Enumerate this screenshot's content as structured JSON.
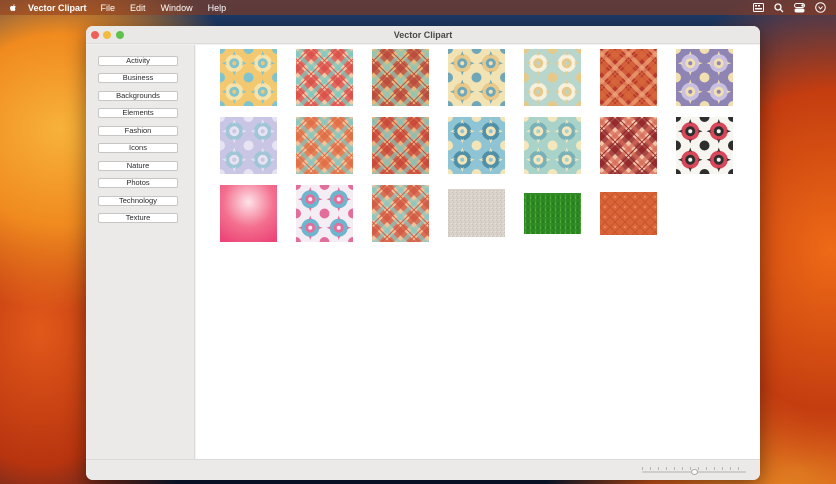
{
  "menubar": {
    "app_name": "Vector Clipart",
    "items": [
      "File",
      "Edit",
      "Window",
      "Help"
    ]
  },
  "window": {
    "title": "Vector Clipart"
  },
  "sidebar": {
    "categories": [
      "Activity",
      "Business",
      "Backgrounds",
      "Elements",
      "Fashion",
      "Icons",
      "Nature",
      "Photos",
      "Technology",
      "Texture"
    ]
  },
  "gallery": {
    "thumbnails": [
      {
        "name": "mandala-yellow-blue",
        "pattern": "mandala",
        "colors": [
          "#f2c870",
          "#7fc3cf",
          "#f7e2a8"
        ]
      },
      {
        "name": "plaid-red-teal",
        "pattern": "plaid",
        "colors": [
          "#d94b47",
          "#74c9c4",
          "#f4c9a6"
        ]
      },
      {
        "name": "plaid-red-olive",
        "pattern": "plaid",
        "colors": [
          "#b6453a",
          "#8cc6b8",
          "#e8b97a"
        ]
      },
      {
        "name": "mandala-cream-teal",
        "pattern": "mandala",
        "colors": [
          "#f2e3b4",
          "#6fa7b8",
          "#e9c989"
        ]
      },
      {
        "name": "mandala-teal-cream",
        "pattern": "mandala",
        "colors": [
          "#b9d6cc",
          "#e6c98a",
          "#f6f0dc"
        ]
      },
      {
        "name": "plaid-orange-red",
        "pattern": "plaid",
        "colors": [
          "#d9683a",
          "#f1a77a",
          "#b83a2f"
        ]
      },
      {
        "name": "mandala-purple-cream",
        "pattern": "mandala",
        "colors": [
          "#8f85b5",
          "#f1dfb0",
          "#c9bfe0"
        ]
      },
      {
        "name": "mandala-lavender",
        "pattern": "mandala",
        "colors": [
          "#c8c6e4",
          "#e8e3f2",
          "#9fc5d6"
        ]
      },
      {
        "name": "plaid-orange-teal",
        "pattern": "plaid",
        "colors": [
          "#de6a43",
          "#7fc6c1",
          "#f2c49c"
        ]
      },
      {
        "name": "plaid-red-teal-2",
        "pattern": "plaid",
        "colors": [
          "#c64236",
          "#85bfb7",
          "#eab27e"
        ]
      },
      {
        "name": "mandala-blue-cream",
        "pattern": "mandala",
        "colors": [
          "#8ec4d4",
          "#f3e5b7",
          "#4f8fa8"
        ]
      },
      {
        "name": "mandala-mint-cream",
        "pattern": "mandala",
        "colors": [
          "#a9d3c8",
          "#f4e6bd",
          "#79b1b8"
        ]
      },
      {
        "name": "plaid-dark-red",
        "pattern": "plaid",
        "colors": [
          "#8e1f24",
          "#d86a56",
          "#f0c4a8"
        ]
      },
      {
        "name": "mandala-white-black-red",
        "pattern": "mandala",
        "colors": [
          "#f7f5f0",
          "#2e2e2e",
          "#d9475b"
        ]
      },
      {
        "name": "gradient-pink",
        "pattern": "gradient",
        "colors": [
          "#fde3e8",
          "#f4708f",
          "#ec4477"
        ]
      },
      {
        "name": "mandala-colorful",
        "pattern": "mandala",
        "colors": [
          "#f4eef4",
          "#e46e9b",
          "#6cb7cf"
        ]
      },
      {
        "name": "plaid-red-teal-3",
        "pattern": "plaid",
        "colors": [
          "#d0553f",
          "#86c8c2",
          "#f1c39a"
        ]
      },
      {
        "name": "texture-grey",
        "pattern": "noise",
        "colors": [
          "#d8d2cb",
          "#c7c0b8",
          "#e6e1db"
        ]
      },
      {
        "name": "texture-grass",
        "pattern": "grass",
        "colors": [
          "#2f8a24",
          "#57b63a",
          "#1d6a17"
        ]
      },
      {
        "name": "texture-orange-hex",
        "pattern": "hex",
        "colors": [
          "#d96438",
          "#c4502b",
          "#e98357"
        ]
      }
    ]
  },
  "zoom": {
    "value": 0.5
  }
}
